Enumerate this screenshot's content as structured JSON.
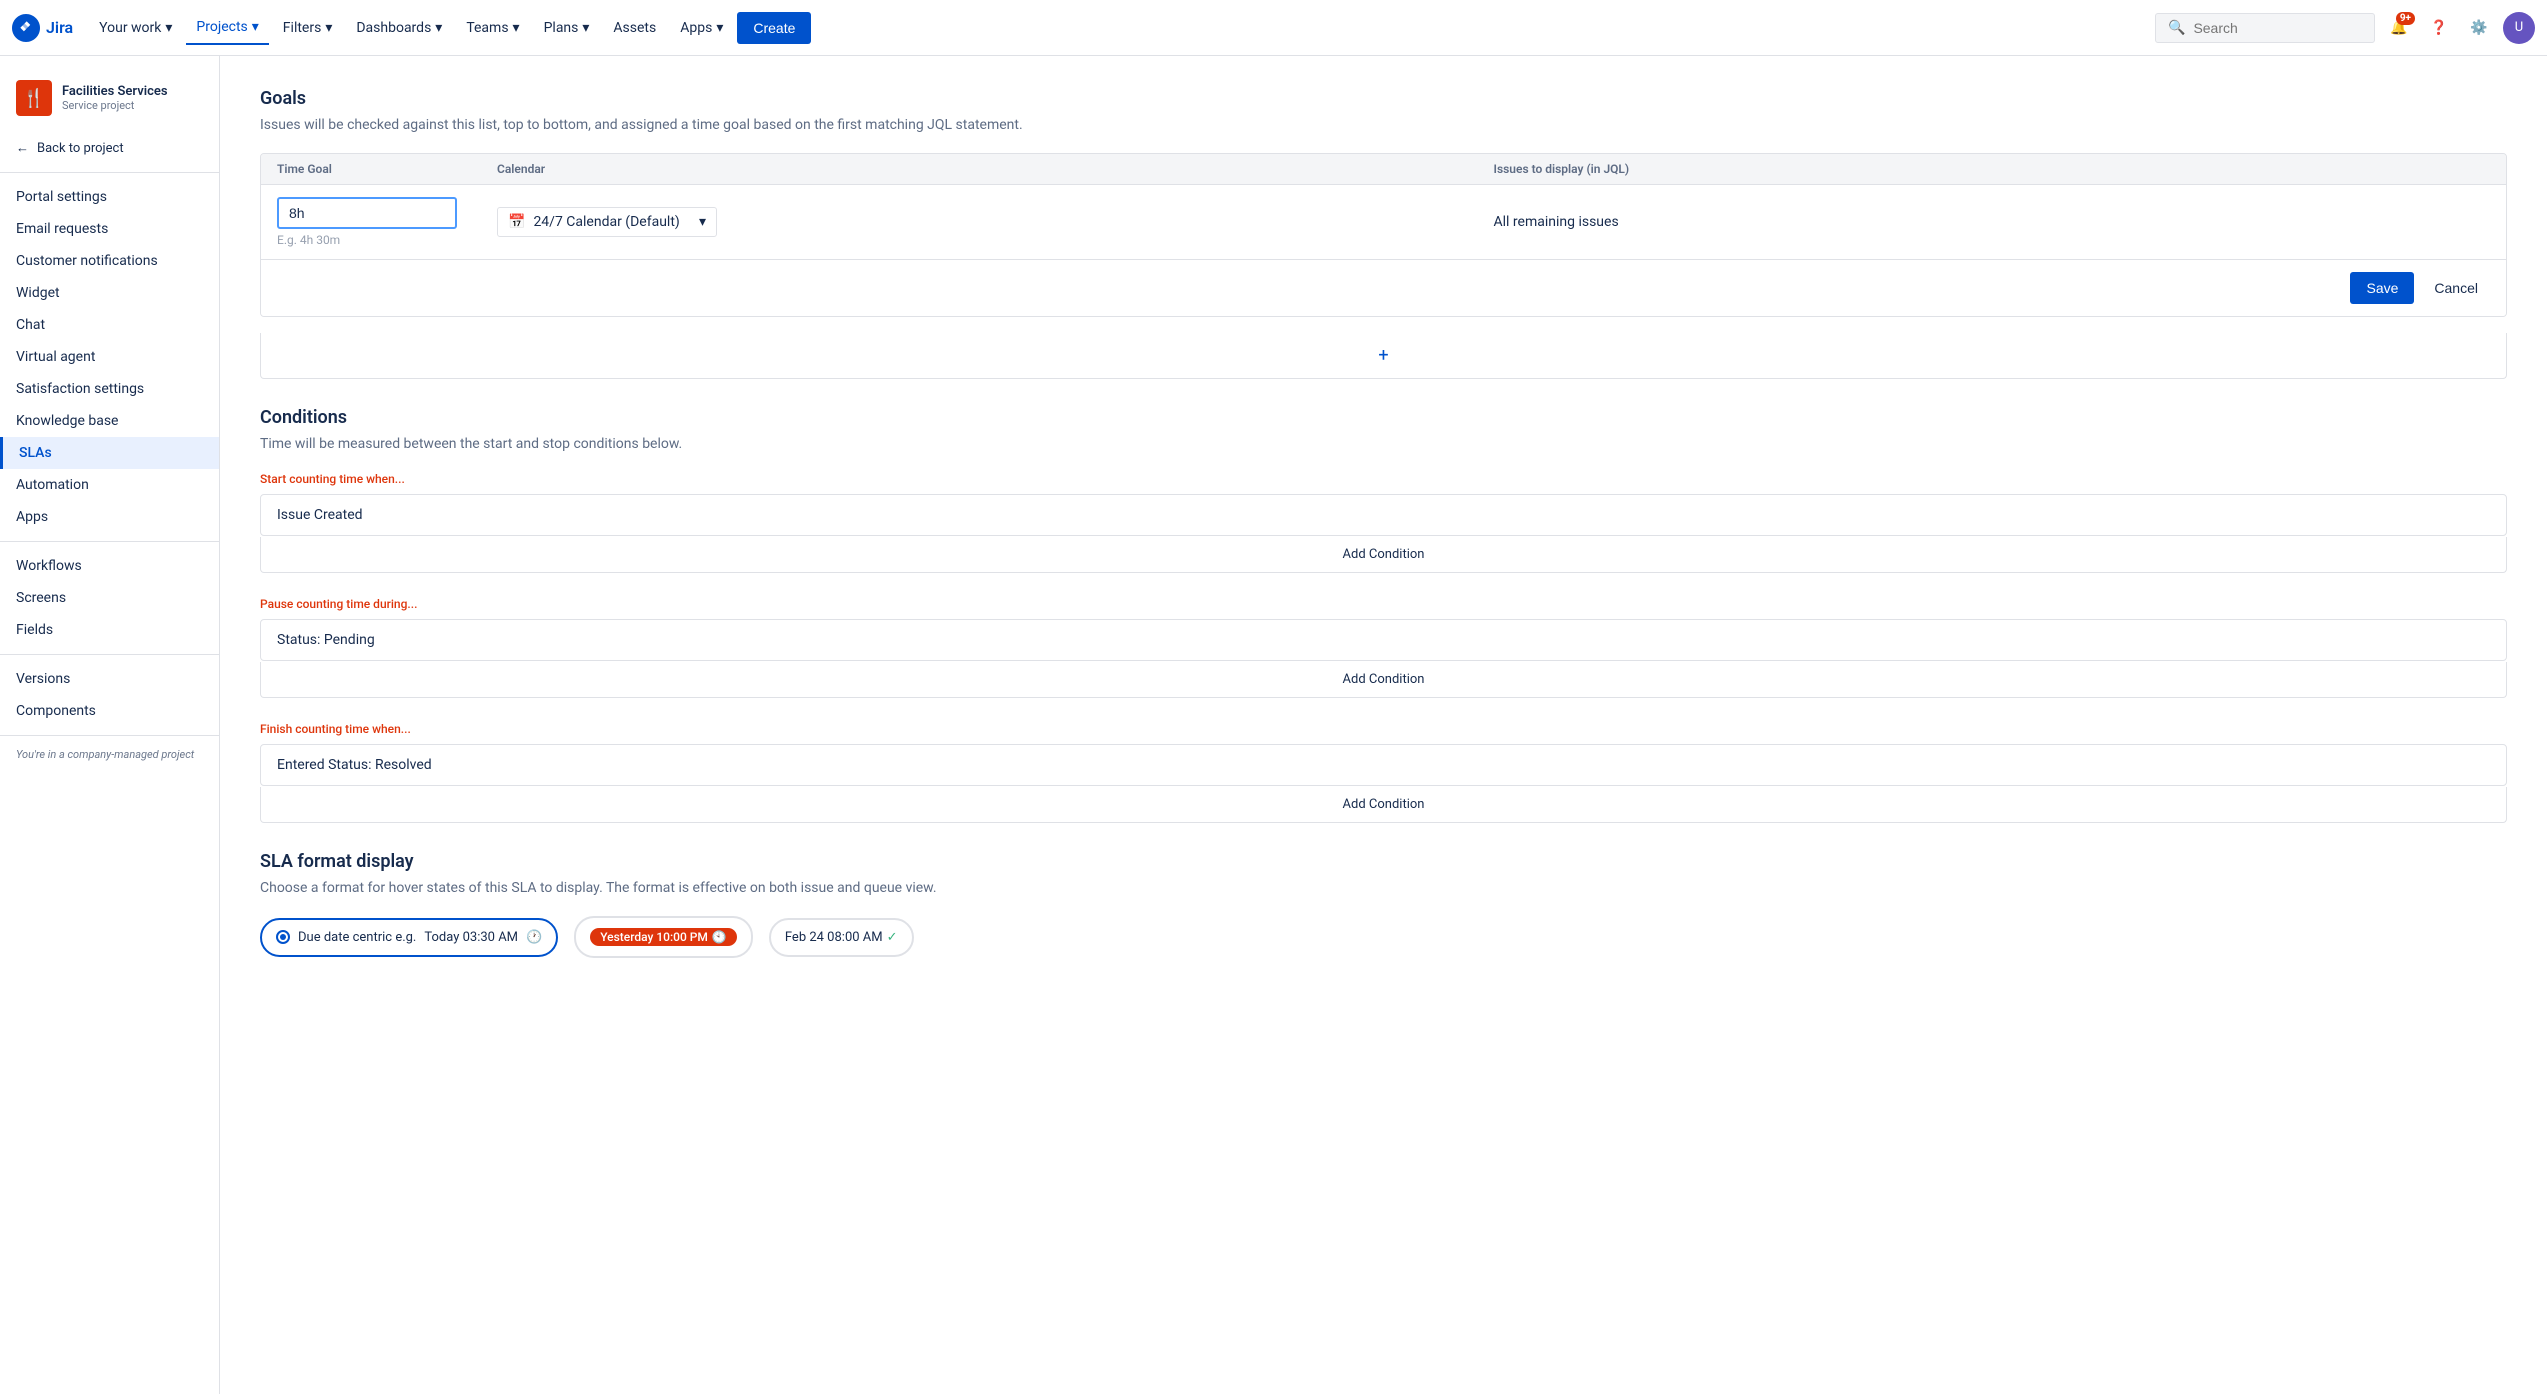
{
  "topnav": {
    "logo_text": "Jira",
    "your_work": "Your work",
    "projects": "Projects",
    "filters": "Filters",
    "dashboards": "Dashboards",
    "teams": "Teams",
    "plans": "Plans",
    "assets": "Assets",
    "apps": "Apps",
    "create": "Create",
    "search_placeholder": "Search",
    "notif_badge": "9+"
  },
  "sidebar": {
    "project_name": "Facilities Services",
    "project_type": "Service project",
    "back_label": "Back to project",
    "items": [
      {
        "label": "Portal settings",
        "id": "portal-settings",
        "active": false
      },
      {
        "label": "Email requests",
        "id": "email-requests",
        "active": false
      },
      {
        "label": "Customer notifications",
        "id": "customer-notifications",
        "active": false
      },
      {
        "label": "Widget",
        "id": "widget",
        "active": false
      },
      {
        "label": "Chat",
        "id": "chat",
        "active": false
      },
      {
        "label": "Virtual agent",
        "id": "virtual-agent",
        "active": false
      },
      {
        "label": "Satisfaction settings",
        "id": "satisfaction-settings",
        "active": false
      },
      {
        "label": "Knowledge base",
        "id": "knowledge-base",
        "active": false
      },
      {
        "label": "SLAs",
        "id": "slas",
        "active": true
      },
      {
        "label": "Automation",
        "id": "automation",
        "active": false
      },
      {
        "label": "Apps",
        "id": "apps",
        "active": false
      }
    ],
    "section2_items": [
      {
        "label": "Workflows",
        "id": "workflows",
        "active": false
      },
      {
        "label": "Screens",
        "id": "screens",
        "active": false
      },
      {
        "label": "Fields",
        "id": "fields",
        "active": false
      }
    ],
    "section3_items": [
      {
        "label": "Versions",
        "id": "versions",
        "active": false
      },
      {
        "label": "Components",
        "id": "components",
        "active": false
      }
    ],
    "footer_text": "You're in a company-managed project"
  },
  "main": {
    "goals": {
      "title": "Goals",
      "description": "Issues will be checked against this list, top to bottom, and assigned a time goal based on the first matching JQL statement.",
      "col_time_goal": "Time Goal",
      "col_calendar": "Calendar",
      "col_issues": "Issues to display (in JQL)",
      "row": {
        "time_value": "8h",
        "time_hint": "E.g. 4h 30m",
        "calendar": "24/7 Calendar (Default)",
        "issues": "All remaining issues"
      },
      "save_btn": "Save",
      "cancel_btn": "Cancel",
      "add_btn": "+"
    },
    "conditions": {
      "title": "Conditions",
      "description": "Time will be measured between the start and stop conditions below.",
      "start": {
        "label": "Start counting time when...",
        "value": "Issue Created",
        "add_btn": "Add Condition"
      },
      "pause": {
        "label": "Pause counting time during...",
        "value": "Status: Pending",
        "add_btn": "Add Condition"
      },
      "finish": {
        "label": "Finish counting time when...",
        "value": "Entered Status: Resolved",
        "add_btn": "Add Condition"
      }
    },
    "sla_format": {
      "title": "SLA format display",
      "description": "Choose a format for hover states of this SLA to display. The format is effective on both issue and queue view.",
      "option1": {
        "label": "Due date centric e.g.",
        "example_text": "Today 03:30 AM"
      },
      "option2": {
        "chip_text": "Yesterday 10:00 PM"
      },
      "option3": {
        "chip_text": "Feb 24 08:00 AM"
      }
    }
  }
}
